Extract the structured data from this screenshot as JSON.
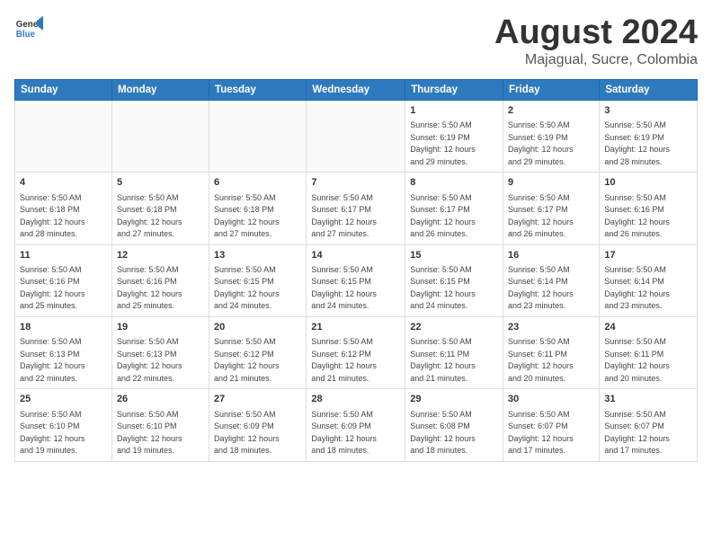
{
  "header": {
    "logo_line1": "General",
    "logo_line2": "Blue",
    "month_year": "August 2024",
    "location": "Majagual, Sucre, Colombia"
  },
  "days_of_week": [
    "Sunday",
    "Monday",
    "Tuesday",
    "Wednesday",
    "Thursday",
    "Friday",
    "Saturday"
  ],
  "weeks": [
    [
      {
        "day": "",
        "info": ""
      },
      {
        "day": "",
        "info": ""
      },
      {
        "day": "",
        "info": ""
      },
      {
        "day": "",
        "info": ""
      },
      {
        "day": "1",
        "info": "Sunrise: 5:50 AM\nSunset: 6:19 PM\nDaylight: 12 hours\nand 29 minutes."
      },
      {
        "day": "2",
        "info": "Sunrise: 5:50 AM\nSunset: 6:19 PM\nDaylight: 12 hours\nand 29 minutes."
      },
      {
        "day": "3",
        "info": "Sunrise: 5:50 AM\nSunset: 6:19 PM\nDaylight: 12 hours\nand 28 minutes."
      }
    ],
    [
      {
        "day": "4",
        "info": "Sunrise: 5:50 AM\nSunset: 6:18 PM\nDaylight: 12 hours\nand 28 minutes."
      },
      {
        "day": "5",
        "info": "Sunrise: 5:50 AM\nSunset: 6:18 PM\nDaylight: 12 hours\nand 27 minutes."
      },
      {
        "day": "6",
        "info": "Sunrise: 5:50 AM\nSunset: 6:18 PM\nDaylight: 12 hours\nand 27 minutes."
      },
      {
        "day": "7",
        "info": "Sunrise: 5:50 AM\nSunset: 6:17 PM\nDaylight: 12 hours\nand 27 minutes."
      },
      {
        "day": "8",
        "info": "Sunrise: 5:50 AM\nSunset: 6:17 PM\nDaylight: 12 hours\nand 26 minutes."
      },
      {
        "day": "9",
        "info": "Sunrise: 5:50 AM\nSunset: 6:17 PM\nDaylight: 12 hours\nand 26 minutes."
      },
      {
        "day": "10",
        "info": "Sunrise: 5:50 AM\nSunset: 6:16 PM\nDaylight: 12 hours\nand 26 minutes."
      }
    ],
    [
      {
        "day": "11",
        "info": "Sunrise: 5:50 AM\nSunset: 6:16 PM\nDaylight: 12 hours\nand 25 minutes."
      },
      {
        "day": "12",
        "info": "Sunrise: 5:50 AM\nSunset: 6:16 PM\nDaylight: 12 hours\nand 25 minutes."
      },
      {
        "day": "13",
        "info": "Sunrise: 5:50 AM\nSunset: 6:15 PM\nDaylight: 12 hours\nand 24 minutes."
      },
      {
        "day": "14",
        "info": "Sunrise: 5:50 AM\nSunset: 6:15 PM\nDaylight: 12 hours\nand 24 minutes."
      },
      {
        "day": "15",
        "info": "Sunrise: 5:50 AM\nSunset: 6:15 PM\nDaylight: 12 hours\nand 24 minutes."
      },
      {
        "day": "16",
        "info": "Sunrise: 5:50 AM\nSunset: 6:14 PM\nDaylight: 12 hours\nand 23 minutes."
      },
      {
        "day": "17",
        "info": "Sunrise: 5:50 AM\nSunset: 6:14 PM\nDaylight: 12 hours\nand 23 minutes."
      }
    ],
    [
      {
        "day": "18",
        "info": "Sunrise: 5:50 AM\nSunset: 6:13 PM\nDaylight: 12 hours\nand 22 minutes."
      },
      {
        "day": "19",
        "info": "Sunrise: 5:50 AM\nSunset: 6:13 PM\nDaylight: 12 hours\nand 22 minutes."
      },
      {
        "day": "20",
        "info": "Sunrise: 5:50 AM\nSunset: 6:12 PM\nDaylight: 12 hours\nand 21 minutes."
      },
      {
        "day": "21",
        "info": "Sunrise: 5:50 AM\nSunset: 6:12 PM\nDaylight: 12 hours\nand 21 minutes."
      },
      {
        "day": "22",
        "info": "Sunrise: 5:50 AM\nSunset: 6:11 PM\nDaylight: 12 hours\nand 21 minutes."
      },
      {
        "day": "23",
        "info": "Sunrise: 5:50 AM\nSunset: 6:11 PM\nDaylight: 12 hours\nand 20 minutes."
      },
      {
        "day": "24",
        "info": "Sunrise: 5:50 AM\nSunset: 6:11 PM\nDaylight: 12 hours\nand 20 minutes."
      }
    ],
    [
      {
        "day": "25",
        "info": "Sunrise: 5:50 AM\nSunset: 6:10 PM\nDaylight: 12 hours\nand 19 minutes."
      },
      {
        "day": "26",
        "info": "Sunrise: 5:50 AM\nSunset: 6:10 PM\nDaylight: 12 hours\nand 19 minutes."
      },
      {
        "day": "27",
        "info": "Sunrise: 5:50 AM\nSunset: 6:09 PM\nDaylight: 12 hours\nand 18 minutes."
      },
      {
        "day": "28",
        "info": "Sunrise: 5:50 AM\nSunset: 6:09 PM\nDaylight: 12 hours\nand 18 minutes."
      },
      {
        "day": "29",
        "info": "Sunrise: 5:50 AM\nSunset: 6:08 PM\nDaylight: 12 hours\nand 18 minutes."
      },
      {
        "day": "30",
        "info": "Sunrise: 5:50 AM\nSunset: 6:07 PM\nDaylight: 12 hours\nand 17 minutes."
      },
      {
        "day": "31",
        "info": "Sunrise: 5:50 AM\nSunset: 6:07 PM\nDaylight: 12 hours\nand 17 minutes."
      }
    ]
  ]
}
